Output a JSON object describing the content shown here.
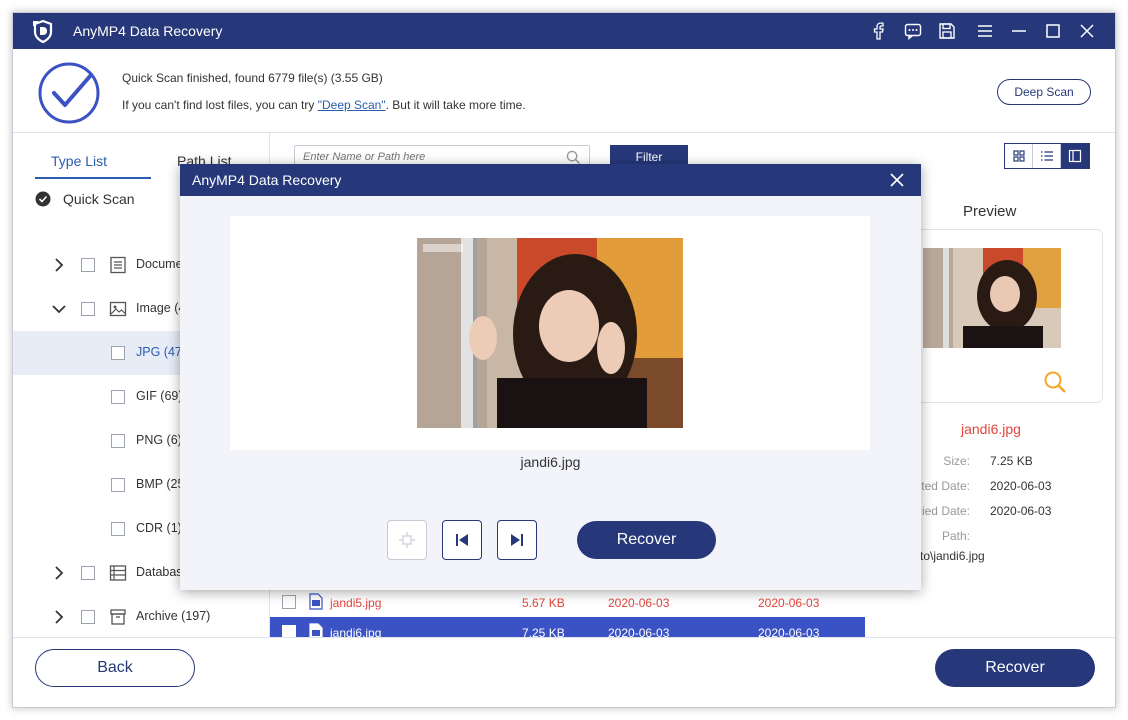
{
  "app": {
    "title": "AnyMP4 Data Recovery"
  },
  "scan": {
    "status": "Quick Scan finished, found 6779 file(s) (3.55 GB)",
    "hint_before": "If you can't find lost files, you can try ",
    "hint_link": "\"Deep Scan\"",
    "hint_after": ". But it will take more time.",
    "deep_scan_label": "Deep Scan"
  },
  "sidebar": {
    "tabs": [
      "Type List",
      "Path List"
    ],
    "quick_scan": "Quick Scan",
    "items": [
      {
        "label": "Docume"
      },
      {
        "label": "Image (4"
      },
      {
        "label": "JPG (47"
      },
      {
        "label": "GIF (69)"
      },
      {
        "label": "PNG (6)"
      },
      {
        "label": "BMP (25"
      },
      {
        "label": "CDR (1)"
      },
      {
        "label": "Databas"
      },
      {
        "label": "Archive (197)"
      }
    ]
  },
  "toolbar": {
    "search_placeholder": "Enter Name or Path here",
    "filter_label": "Filter"
  },
  "files": [
    {
      "name": "jandi5.jpg",
      "size": "5.67 KB",
      "created": "2020-06-03",
      "modified": "2020-06-03"
    },
    {
      "name": "jandi6.jpg",
      "size": "7.25 KB",
      "created": "2020-06-03",
      "modified": "2020-06-03"
    }
  ],
  "preview": {
    "title": "Preview",
    "filename": "jandi6.jpg",
    "size_label": "Size:",
    "size": "7.25 KB",
    "created_label": "ted Date:",
    "created": "2020-06-03",
    "modified_label": "ied Date:",
    "modified": "2020-06-03",
    "path_label": "Path:",
    "path": "to\\jandi6.jpg"
  },
  "footer": {
    "back_label": "Back",
    "recover_label": "Recover"
  },
  "modal": {
    "title": "AnyMP4 Data Recovery",
    "filename": "jandi6.jpg",
    "recover_label": "Recover"
  },
  "colors": {
    "brand": "#27387a",
    "accent": "#3b52c4",
    "highlight": "#e2453c",
    "zoom": "#f5a623"
  }
}
